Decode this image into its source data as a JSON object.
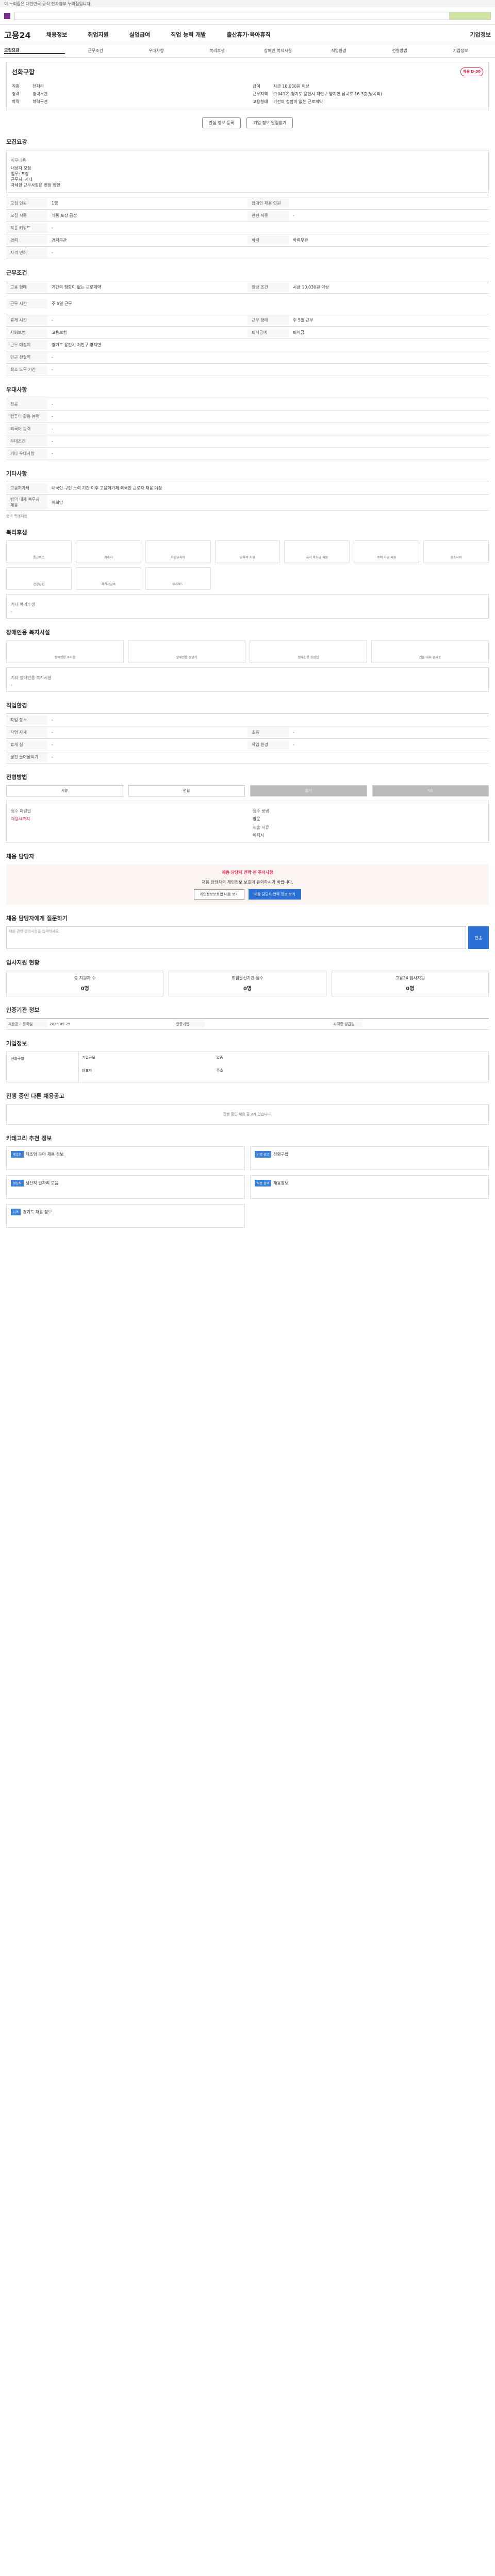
{
  "gov": "이 누리집은 대한민국 공식 전자정부 누리집입니다.",
  "header": {
    "search_placeholder": "검색"
  },
  "nav": {
    "brand": "고용24",
    "items": [
      "채용정보",
      "취업지원",
      "실업급여",
      "직업 능력 개발",
      "출산휴가·육아휴직"
    ],
    "right": "기업정보"
  },
  "tabs": [
    "모집요강",
    "근무조건",
    "우대사항",
    "복리후생",
    "장애인 복지시설",
    "직업환경",
    "전형방법",
    "기업정보"
  ],
  "company": {
    "name": "선화구합",
    "badge": "채용 D-30",
    "job_label": "직종",
    "job": "전처리",
    "salary_label": "급여",
    "salary": "시급 10,030원 이상",
    "career_label": "경력",
    "career": "경력무관",
    "loc_label": "근무지역",
    "loc": "(10412) 경기도 용인시 처인구 양지면 남곡로 16 3층(남곡리)",
    "edu_label": "학력",
    "edu": "학력무관",
    "form_label": "고용형태",
    "form": "기간의 정함이 없는 근로계약"
  },
  "actions": [
    "관심 정보 등록",
    "기업 정보 알림받기"
  ],
  "recruit": {
    "title": "모집요강",
    "job_title": "직무내용",
    "lines": [
      "대상자 모집",
      "업무: 포장",
      "근무지: 사내",
      "자세한 근무사항은 현장 확인"
    ],
    "rows": [
      [
        "모집 인원",
        "1명",
        "장애인 채용 인원",
        ""
      ],
      [
        "모집 직종",
        "식품 포장 공정",
        "관련 직종",
        "-"
      ],
      [
        "직종 키워드",
        "-",
        "",
        ""
      ],
      [
        "경력",
        "경력무관",
        "학력",
        "학력무관"
      ],
      [
        "자격 면허",
        "-",
        "",
        ""
      ]
    ]
  },
  "conditions": {
    "title": "근무조건",
    "rows": [
      [
        "고용 형태",
        "기간의 정함이 없는 근로계약",
        "임금 조건",
        "시급 10,030원 이상"
      ],
      [
        "근무 시간",
        "주 5일 근무",
        "",
        ""
      ],
      [
        "휴게 시간",
        "-",
        "근무 형태",
        "주 5일 근무"
      ],
      [
        "사회보험",
        "고용보험",
        "퇴직급여",
        "퇴직금"
      ],
      [
        "근무 예정지",
        "경기도 용인시 처인구 양지면",
        "",
        ""
      ],
      [
        "인근 전철역",
        "-",
        "",
        ""
      ],
      [
        "최소 노무 기간",
        "-",
        "",
        ""
      ]
    ]
  },
  "pref": {
    "title": "우대사항",
    "rows": [
      [
        "전공",
        "-"
      ],
      [
        "컴퓨터 활용 능력",
        "-"
      ],
      [
        "외국어 능력",
        "-"
      ],
      [
        "우대조건",
        "-"
      ],
      [
        "기타 우대사항",
        "-"
      ]
    ]
  },
  "other": {
    "title": "기타사항",
    "rows": [
      [
        "고용허가제",
        "내국인 구인 노력 기간 이후 고용허가제 외국인 근로자 채용 예정"
      ],
      [
        "병역 대체 복무자 채용",
        "비희망"
      ]
    ],
    "link": "병역 특례채용"
  },
  "welfare": {
    "title": "복리후생",
    "items": [
      "통근버스",
      "기숙사",
      "차량유지비",
      "교육비 지원",
      "자녀 학자금 지원",
      "주택 자금 지원",
      "경조사비",
      "건강검진",
      "자기개발비",
      "휴가제도"
    ],
    "extra_label": "기타 복리후생",
    "extra": "-"
  },
  "facility": {
    "title": "장애인용 복지시설",
    "items": [
      "장애인용 주차장",
      "장애인용 승강기",
      "장애인용 화장실",
      "건물 내부 경사로"
    ],
    "extra_label": "기타 장애인용 복지시설",
    "extra": "-"
  },
  "env": {
    "title": "직업환경",
    "rows": [
      [
        "작업 장소",
        "-"
      ],
      [
        "작업 자세",
        "-"
      ],
      [
        "휴게 실",
        "-"
      ],
      [
        "물건 들어올리기",
        "-"
      ],
      [
        "소음",
        "-"
      ],
      [
        "작업 환경",
        "-"
      ]
    ]
  },
  "method": {
    "title": "전형방법",
    "items": [
      "서류",
      "면접",
      "필기",
      "기타"
    ],
    "period_label": "접수 마감일",
    "period": "채용시까지",
    "how_label": "접수 방법",
    "how": "방문",
    "doc_label": "제출 서류",
    "doc": "이력서"
  },
  "contact": {
    "title": "채용 담당자",
    "warn": "채용 담당자 연락 전 주의사항",
    "desc": "채용 담당자의 개인정보 보호에 유의하시기 바랍니다.",
    "btns": [
      "개인정보보호법 내용 보기",
      "채용 담당자 연락 정보 보기"
    ]
  },
  "inquiry": {
    "title": "채용 담당자에게 질문하기",
    "placeholder": "채용 관련 문의사항을 입력하세요.",
    "submit": "전송"
  },
  "status": {
    "title": "입사지원 현황",
    "items": [
      [
        "총 지원자 수",
        "0명"
      ],
      [
        "취업알선기관 접수",
        "0명"
      ],
      [
        "고용24 입사지원",
        "0명"
      ]
    ]
  },
  "info": {
    "title": "인증기관 정보",
    "rows": [
      [
        "채용공고 등록일",
        "2025.09.29",
        "인증기업",
        "",
        "자격증 발급일",
        ""
      ]
    ]
  },
  "biz": {
    "title": "기업정보",
    "name": "선화구합",
    "rows": [
      [
        "기업규모",
        "",
        "업종",
        ""
      ],
      [
        "대표자",
        "",
        "주소",
        ""
      ]
    ]
  },
  "related": {
    "title": "진행 중인 다른 채용공고",
    "empty": "진행 중인 채용 공고가 없습니다."
  },
  "bulletin": {
    "title": "카테고리 추천 정보",
    "items": [
      [
        "제조업",
        "제조업 분야 채용 정보"
      ],
      [
        "기업 공고",
        "선화구합"
      ],
      [
        "생산직",
        "생산직 일자리 모음"
      ],
      [
        "직종 검색",
        "채용정보"
      ],
      [
        "지역",
        "경기도 채용 정보"
      ]
    ]
  }
}
